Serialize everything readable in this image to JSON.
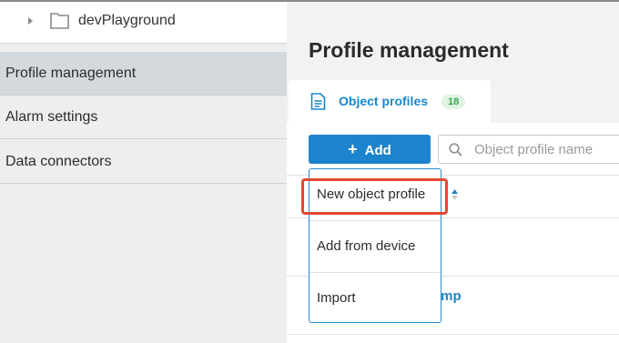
{
  "sidebar": {
    "tree": {
      "label": "devPlayground"
    },
    "items": [
      {
        "label": "Profile management",
        "active": true
      },
      {
        "label": "Alarm settings",
        "active": false
      },
      {
        "label": "Data connectors",
        "active": false
      }
    ]
  },
  "main": {
    "title": "Profile management",
    "tab": {
      "label": "Object profiles",
      "count": "18"
    },
    "toolbar": {
      "add_label": "Add",
      "add_icon": "plus-icon"
    },
    "search": {
      "placeholder": "Object profile name"
    },
    "background_row": {
      "partial_label": "ump"
    }
  },
  "dropdown": {
    "items": [
      {
        "label": "New object profile",
        "highlighted": true
      },
      {
        "label": "Add from device"
      },
      {
        "label": "Import"
      }
    ]
  },
  "colors": {
    "accent": "#1c84cc",
    "badge_bg": "#dff4e2",
    "badge_text": "#3aa44f",
    "highlight": "#e3492f",
    "active_nav": "#d4d9de"
  }
}
